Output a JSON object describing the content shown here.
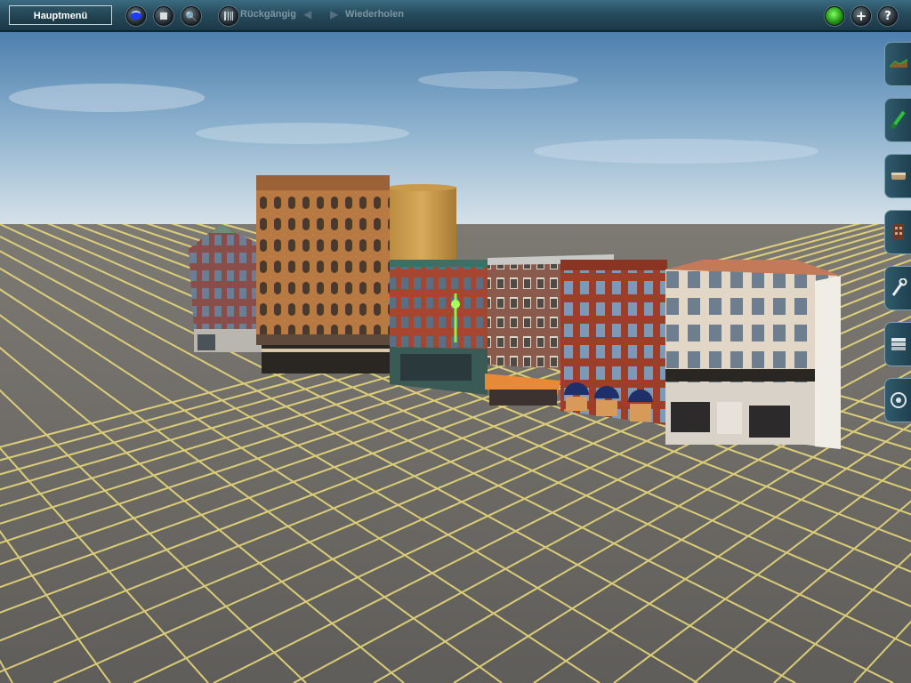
{
  "toolbar": {
    "main_menu_label": "Hauptmenü",
    "undo_label": "Rückgängig",
    "redo_label": "Wiederholen"
  },
  "icons": {
    "left_tools": [
      "camera-icon",
      "stop-icon",
      "search-icon",
      "grid-icon"
    ],
    "right_tools": [
      "status-light-icon",
      "plus-icon",
      "help-icon"
    ],
    "palette": [
      "terrain-icon",
      "paint-icon",
      "track-icon",
      "scenery-object-icon",
      "tool-icon",
      "layers-icon",
      "settings-icon"
    ]
  },
  "colors": {
    "toolbar": "#274b5c",
    "grid_line": "#e8d97a",
    "ground": "#6e6c68",
    "sky_top": "#4d7fae",
    "status_light": "#3fd62a"
  }
}
